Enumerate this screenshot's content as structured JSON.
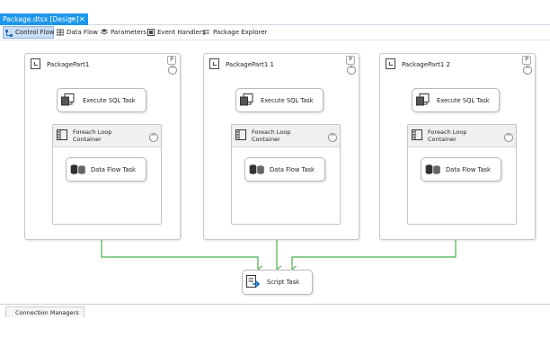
{
  "doc_tab": {
    "title": "Package.dtsx [Design]",
    "pin": "↪",
    "close": "✕"
  },
  "toolbar": {
    "tabs": [
      {
        "label": "Control Flow",
        "icon": "control-flow-icon",
        "active": true
      },
      {
        "label": "Data Flow",
        "icon": "data-flow-icon",
        "active": false
      },
      {
        "label": "Parameters",
        "icon": "parameters-icon",
        "active": false
      },
      {
        "label": "Event Handlers",
        "icon": "event-handlers-icon",
        "active": false
      },
      {
        "label": "Package Explorer",
        "icon": "package-explorer-icon",
        "active": false
      }
    ]
  },
  "sequences": [
    {
      "title": "PackagePart1",
      "badge": "P",
      "collapse": "^",
      "sql_task": "Execute SQL Task",
      "loop_title": "Foreach Loop Container",
      "data_flow_task": "Data Flow Task"
    },
    {
      "title": "PackagePart1 1",
      "badge": "P",
      "collapse": "^",
      "sql_task": "Execute SQL Task",
      "loop_title": "Foreach Loop Container",
      "data_flow_task": "Data Flow Task"
    },
    {
      "title": "PackagePart1 2",
      "badge": "P",
      "collapse": "^",
      "sql_task": "Execute SQL Task",
      "loop_title": "Foreach Loop Container",
      "data_flow_task": "Data Flow Task"
    }
  ],
  "script_task": {
    "label": "Script Task"
  },
  "connection_managers": {
    "label": "Connection Managers"
  },
  "colors": {
    "accent": "#1c97ea",
    "precedence": "#4caf50"
  }
}
